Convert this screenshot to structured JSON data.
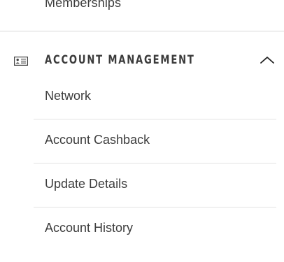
{
  "previous_item": {
    "label": "Memberships"
  },
  "section": {
    "title": "ACCOUNT MANAGEMENT",
    "icon": "id-card-icon",
    "expanded": true,
    "toggle_icon": "chevron-up-icon"
  },
  "submenu": {
    "items": [
      {
        "label": "Network"
      },
      {
        "label": "Account Cashback"
      },
      {
        "label": "Update Details"
      },
      {
        "label": "Account History"
      }
    ]
  }
}
